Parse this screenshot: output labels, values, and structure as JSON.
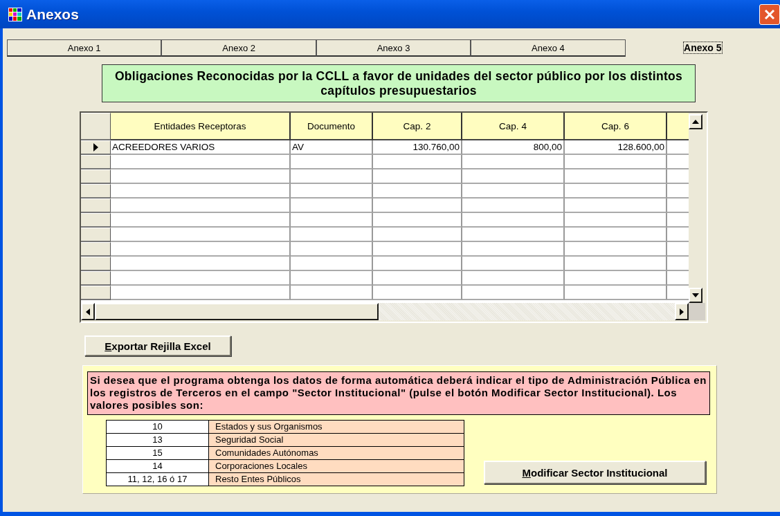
{
  "window": {
    "title": "Anexos"
  },
  "tabs": [
    {
      "label": "Anexo 1",
      "selected": false
    },
    {
      "label": "Anexo 2",
      "selected": false
    },
    {
      "label": "Anexo 3",
      "selected": false
    },
    {
      "label": "Anexo 4",
      "selected": false
    },
    {
      "label": "Anexo 5",
      "selected": true
    }
  ],
  "heading": "Obligaciones Reconocidas por la CCLL a favor de unidades del sector público por los distintos capítulos presupuestarios",
  "table": {
    "columns": [
      "Entidades Receptoras",
      "Documento",
      "Cap. 2",
      "Cap. 4",
      "Cap. 6"
    ],
    "rows": [
      {
        "selected": true,
        "cells": [
          "ACREEDORES VARIOS",
          "AV",
          "130.760,00",
          "800,00",
          "128.600,00"
        ]
      }
    ]
  },
  "export_button": "Exportar Rejilla Excel",
  "info": {
    "message": "Si desea que el programa obtenga los datos de forma automática deberá indicar el tipo de Administración Pública en los registros de Terceros en el campo \"Sector Institucional\" (pulse el botón Modificar Sector Institucional). Los valores posibles son:",
    "values": [
      {
        "code": "10",
        "label": "Estados y sus Organismos"
      },
      {
        "code": "13",
        "label": "Seguridad Social"
      },
      {
        "code": "15",
        "label": "Comunidades Autónomas"
      },
      {
        "code": "14",
        "label": "Corporaciones Locales"
      },
      {
        "code": "11, 12, 16 ó 17",
        "label": "Resto Entes Públicos"
      }
    ]
  },
  "modify_button": "Modificar Sector Institucional"
}
